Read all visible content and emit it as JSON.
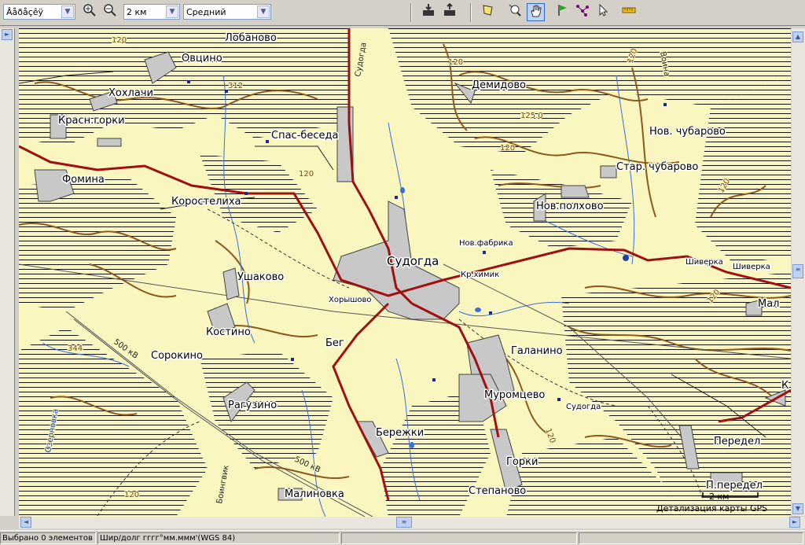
{
  "toolbar": {
    "coord_format_combo": "Âåðåçêÿ",
    "zoom_in_icon": "magnifier-plus-icon",
    "zoom_out_icon": "magnifier-minus-icon",
    "scale_combo": "2 км",
    "detail_combo": "Средний",
    "tools": [
      "send-to-device-icon",
      "receive-from-device-icon",
      "select-area-icon",
      "zoom-tool-icon",
      "pan-hand-icon",
      "waypoint-flag-icon",
      "route-tool-icon",
      "pointer-arrow-icon",
      "measure-ruler-icon"
    ]
  },
  "map": {
    "settlements": [
      {
        "name": "Лобаново"
      },
      {
        "name": "Овцино"
      },
      {
        "name": "Хохлачи"
      },
      {
        "name": "Красн.горки"
      },
      {
        "name": "Фоминa"
      },
      {
        "name": "Коростелиха"
      },
      {
        "name": "Спас-беседа"
      },
      {
        "name": "Демидово"
      },
      {
        "name": "Нов. чубарово"
      },
      {
        "name": "Стар. чубарово"
      },
      {
        "name": "Нов.полхово"
      },
      {
        "name": "Нов.фабрика"
      },
      {
        "name": "Судогда"
      },
      {
        "name": "Кр.химик"
      },
      {
        "name": "Шиверка"
      },
      {
        "name": "Шиверка"
      },
      {
        "name": "Ушаково"
      },
      {
        "name": "Хорышово"
      },
      {
        "name": "Костино"
      },
      {
        "name": "Бег"
      },
      {
        "name": "Сорокино"
      },
      {
        "name": "Галанино"
      },
      {
        "name": "Муромцево"
      },
      {
        "name": "Судогда"
      },
      {
        "name": "Рагузино"
      },
      {
        "name": "Бережки"
      },
      {
        "name": "Горки"
      },
      {
        "name": "Передел"
      },
      {
        "name": "П.передел"
      },
      {
        "name": "Малиновка"
      },
      {
        "name": "Степаново"
      },
      {
        "name": "Мал"
      },
      {
        "name": "К"
      }
    ],
    "road_labels": [
      "Судогда",
      "500 кВ",
      "500 кВ",
      "Боингвик",
      "Озерновка",
      "Воина"
    ],
    "contour_labels": [
      "120",
      "120",
      "120",
      "125.0",
      "120",
      "120",
      "120",
      "120",
      "120",
      "120",
      "312",
      "344"
    ],
    "scale_bar": "2 км",
    "detail_note": "Детализация карты GPS",
    "colors": {
      "road": "#a01010",
      "water": "#3a6fd8",
      "contour": "#8b5a1a",
      "settlement": "#c8c8c8",
      "forest_hatch": "#000000",
      "background": "#faf6c0"
    }
  },
  "status": {
    "selected": "Выбрано 0 элементов",
    "coord_format": "Шир/долг гггг°мм.ммм'(WGS 84)",
    "panel3": "",
    "panel4": ""
  }
}
